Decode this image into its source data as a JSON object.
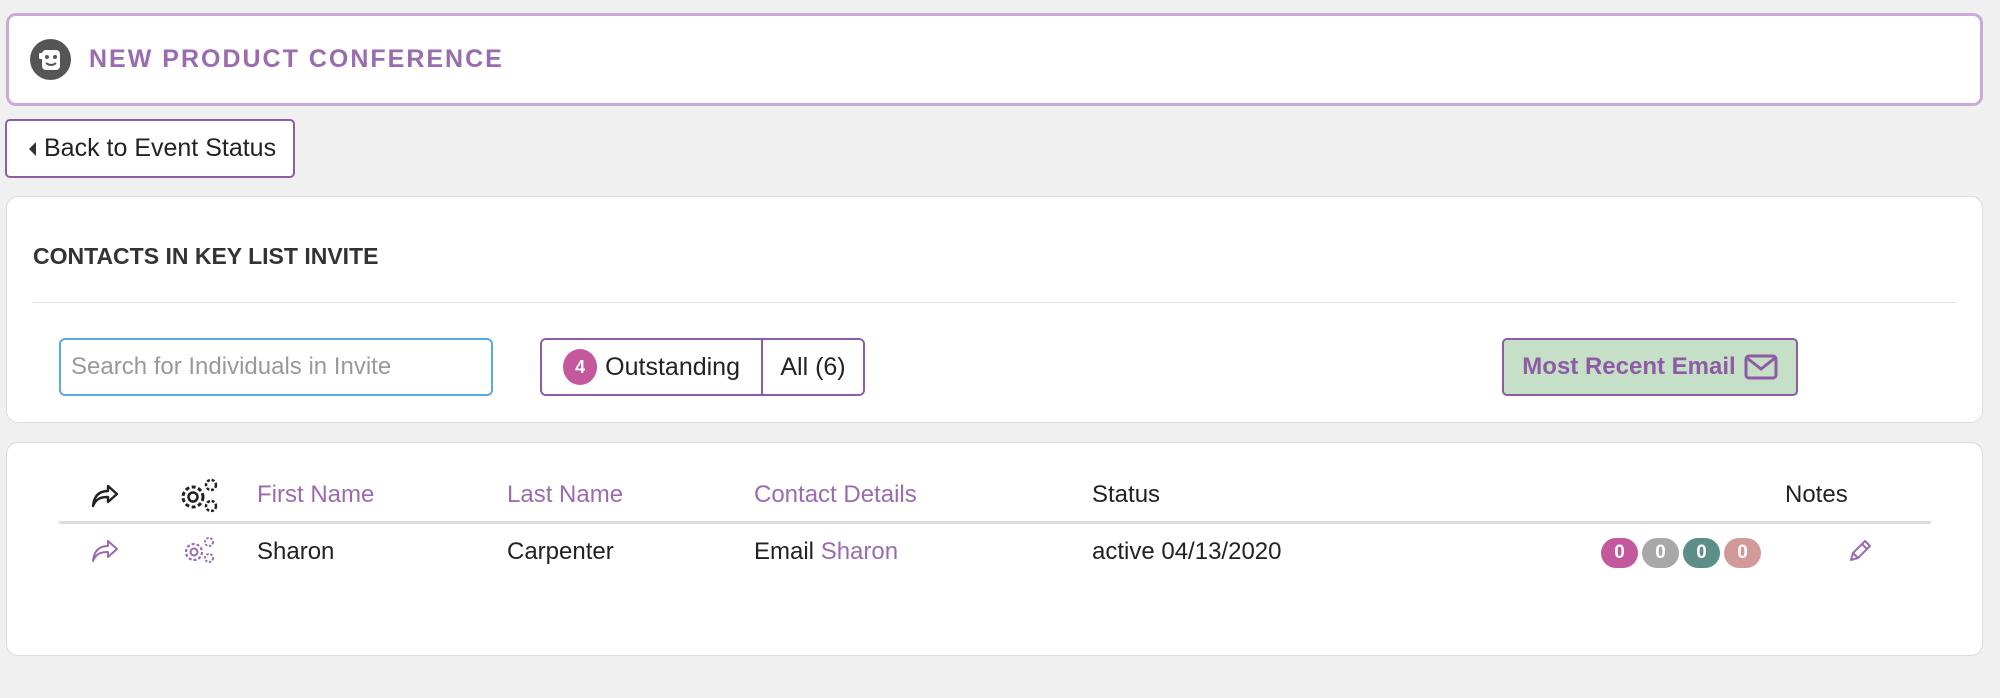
{
  "header": {
    "title": "NEW PRODUCT CONFERENCE",
    "logo_icon": "logo-icon"
  },
  "back_button": {
    "label": "Back to Event Status"
  },
  "contacts_panel": {
    "title": "CONTACTS IN KEY LIST INVITE",
    "search_placeholder": "Search for Individuals in Invite",
    "filters": {
      "outstanding_count": "4",
      "outstanding_label": "Outstanding",
      "all_label": "All (6)"
    },
    "recent_email_label": "Most Recent Email"
  },
  "table": {
    "headers": {
      "first_name": "First Name",
      "last_name": "Last Name",
      "contact_details": "Contact Details",
      "status": "Status",
      "notes": "Notes"
    },
    "rows": [
      {
        "first_name": "Sharon",
        "last_name": "Carpenter",
        "contact_prefix": "Email",
        "contact_link": "Sharon",
        "status": "active 04/13/2020",
        "counts": [
          "0",
          "0",
          "0",
          "0"
        ]
      }
    ]
  },
  "colors": {
    "accent": "#9b6bb0",
    "border": "#8e5ba5",
    "pill_pink": "#c3589c",
    "pill_gray": "#a8a8a8",
    "pill_teal": "#5e8e8a",
    "pill_rose": "#d19a98",
    "email_bg": "#c6e0c8"
  }
}
